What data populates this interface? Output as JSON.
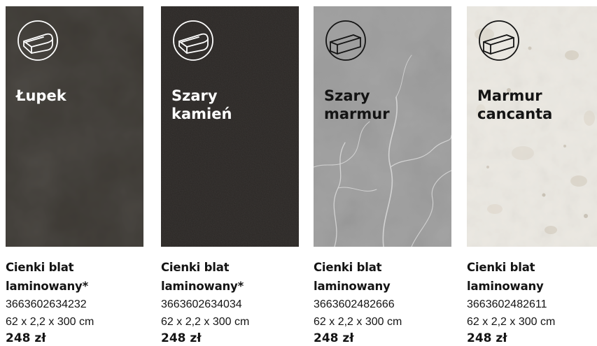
{
  "products": [
    {
      "tile_title": "Łupek",
      "tile_text_color": "#ffffff",
      "icon": "rounded-edge-countertop-icon",
      "icon_color": "#ffffff",
      "name": "Cienki blat\nlaminowany*",
      "code": "3663602634232",
      "dimensions": "62 x 2,2 x 300 cm",
      "price": "248 zł",
      "colors": {
        "base": "#3a3631",
        "dark": "#2a2622",
        "light": "#4b4640"
      }
    },
    {
      "tile_title": "Szary\nkamień",
      "tile_text_color": "#ffffff",
      "icon": "rounded-edge-countertop-icon",
      "icon_color": "#ffffff",
      "name": "Cienki blat\nlaminowany*",
      "code": "3663602634034",
      "dimensions": "62 x 2,2 x 300 cm",
      "price": "248 zł",
      "colors": {
        "base": "#2b2725",
        "dark": "#211e1c",
        "light": "#35302d"
      }
    },
    {
      "tile_title": "Szary\nmarmur",
      "tile_text_color": "#141414",
      "icon": "square-edge-countertop-icon",
      "icon_color": "#141414",
      "name": "Cienki blat\nlaminowany",
      "code": "3663602482666",
      "dimensions": "62 x 2,2 x 300 cm",
      "price": "248 zł",
      "colors": {
        "base": "#9c9c9c",
        "dark": "#858585",
        "light": "#b8b8b8"
      }
    },
    {
      "tile_title": "Marmur\ncancanta",
      "tile_text_color": "#141414",
      "icon": "square-edge-countertop-icon",
      "icon_color": "#141414",
      "name": "Cienki blat\nlaminowany",
      "code": "3663602482611",
      "dimensions": "62 x 2,2 x 300 cm",
      "price": "248 zł",
      "colors": {
        "base": "#ebe8e2",
        "dark": "#d6d2c9",
        "light": "#f6f4ef"
      }
    }
  ]
}
